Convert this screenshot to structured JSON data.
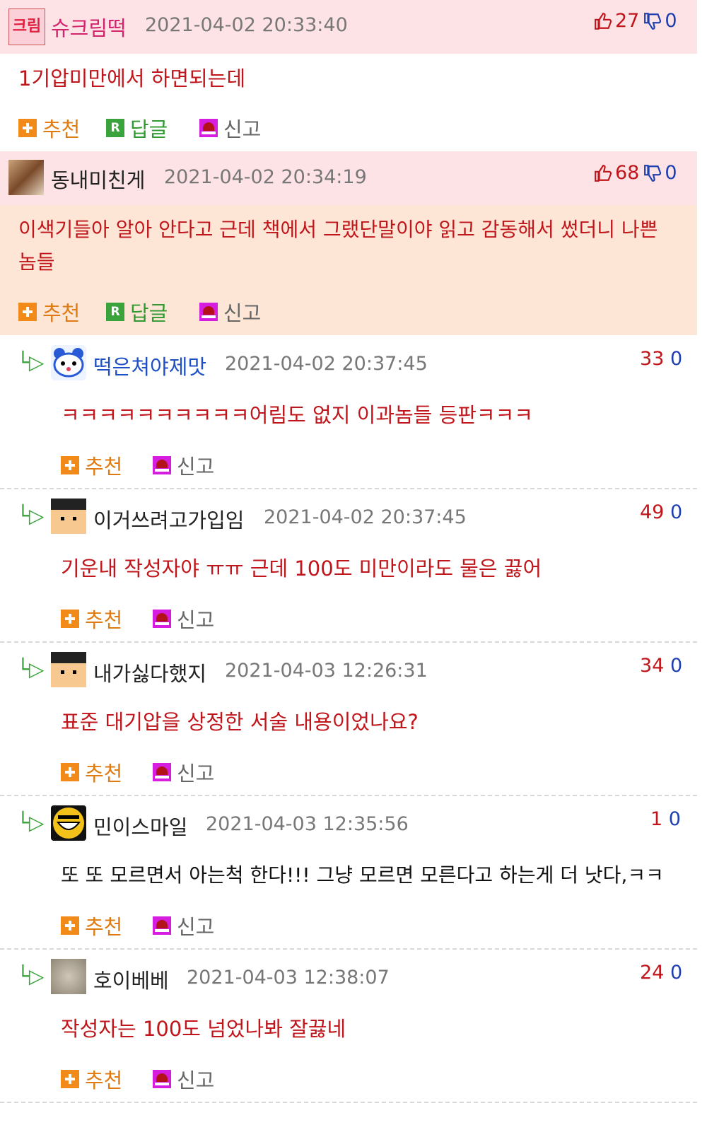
{
  "labels": {
    "recommend": "추천",
    "reply": "답글",
    "report": "신고",
    "reply_badge": "R"
  },
  "colors": {
    "header_bg": "#fde3e5",
    "highlight_bg": "#fde6d6",
    "red": "#c0161b",
    "blue": "#1e3fb0",
    "green": "#3aa33b",
    "orange": "#f28a1a"
  },
  "comments": [
    {
      "author": "슈크림떡",
      "date": "2021-04-02 20:33:40",
      "up": "27",
      "down": "0",
      "text": "1기압미만에서 하면되는데",
      "avatar": "text-avatar-icon",
      "avatar_text": "크림"
    },
    {
      "author": "동내미친게",
      "date": "2021-04-02 20:34:19",
      "up": "68",
      "down": "0",
      "text": "이색기들아 알아 안다고 근데 책에서 그랬단말이야 읽고 감동해서 썼더니 나쁜",
      "text2": "놈들",
      "avatar": "photo-avatar-icon"
    }
  ],
  "replies": [
    {
      "author": "떡은쳐야제맛",
      "date": "2021-04-02 20:37:45",
      "up": "33",
      "down": "0",
      "text": "ㅋㅋㅋㅋㅋㅋㅋㅋㅋㅋ어림도 없지 이과놈들 등판ㅋㅋㅋ",
      "avatar": "hamster-avatar-icon"
    },
    {
      "author": "이거쓰려고가입임",
      "date": "2021-04-02 20:37:45",
      "up": "49",
      "down": "0",
      "text": "기운내 작성자야 ㅠㅠ 근데 100도 미만이라도 물은 끓어",
      "avatar": "graduate-avatar-icon"
    },
    {
      "author": "내가싫다했지",
      "date": "2021-04-03 12:26:31",
      "up": "34",
      "down": "0",
      "text": "표준 대기압을 상정한 서술 내용이었나요?",
      "avatar": "graduate-avatar-icon"
    },
    {
      "author": "민이스마일",
      "date": "2021-04-03 12:35:56",
      "up": "1",
      "down": "0",
      "text": "또 또 모르면서 아는척 한다!!! 그냥 모르면 모른다고 하는게 더 낫다,ㅋㅋ",
      "avatar": "smile-avatar-icon"
    },
    {
      "author": "호이베베",
      "date": "2021-04-03 12:38:07",
      "up": "24",
      "down": "0",
      "text": "작성자는 100도 넘었나봐 잘끓네",
      "avatar": "blur-avatar-icon"
    }
  ]
}
